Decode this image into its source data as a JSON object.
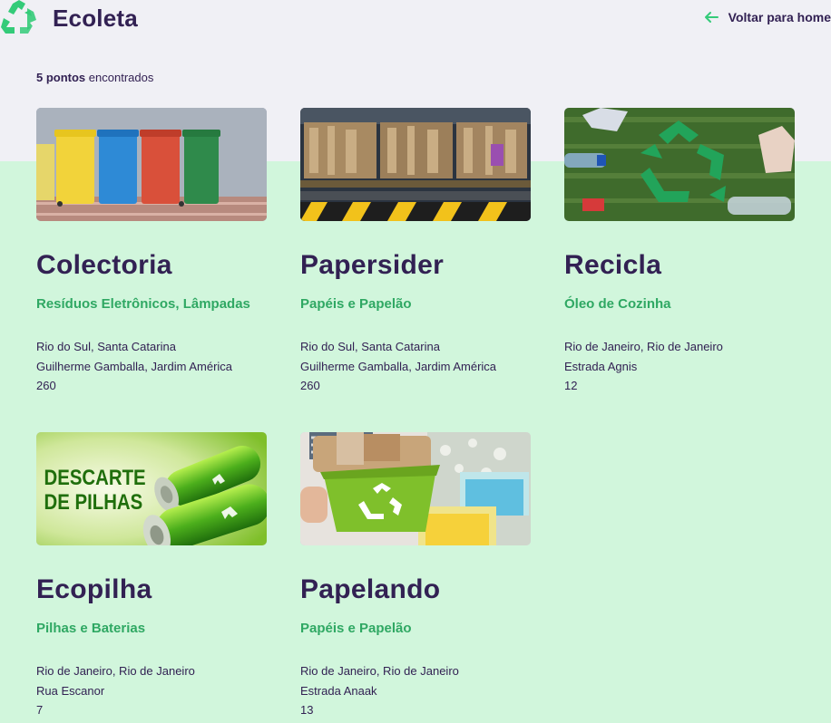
{
  "header": {
    "app_name": "Ecoleta",
    "back_label": "Voltar para home"
  },
  "results": {
    "count_bold": "5 pontos",
    "count_rest": " encontrados"
  },
  "points": [
    {
      "name": "Colectoria",
      "items": "Resíduos Eletrônicos, Lâmpadas",
      "city_uf": "Rio do Sul, Santa Catarina",
      "street": "Guilherme Gamballa, Jardim América",
      "number": "260"
    },
    {
      "name": "Papersider",
      "items": "Papéis e Papelão",
      "city_uf": "Rio do Sul, Santa Catarina",
      "street": "Guilherme Gamballa, Jardim América",
      "number": "260"
    },
    {
      "name": "Recicla",
      "items": "Óleo de Cozinha",
      "city_uf": "Rio de Janeiro, Rio de Janeiro",
      "street": "Estrada Agnis",
      "number": "12"
    },
    {
      "name": "Ecopilha",
      "items": "Pilhas e Baterias",
      "city_uf": "Rio de Janeiro, Rio de Janeiro",
      "street": "Rua Escanor",
      "number": "7"
    },
    {
      "name": "Papelando",
      "items": "Papéis e Papelão",
      "city_uf": "Rio de Janeiro, Rio de Janeiro",
      "street": "Estrada Anaak",
      "number": "13"
    }
  ],
  "images": {
    "battery_text_line1": "DESCARTE",
    "battery_text_line2": "DE PILHAS"
  },
  "colors": {
    "title": "#322153",
    "accent": "#34CB79",
    "page_bg": "#F0F0F5",
    "list_bg": "#D1F6DC"
  }
}
